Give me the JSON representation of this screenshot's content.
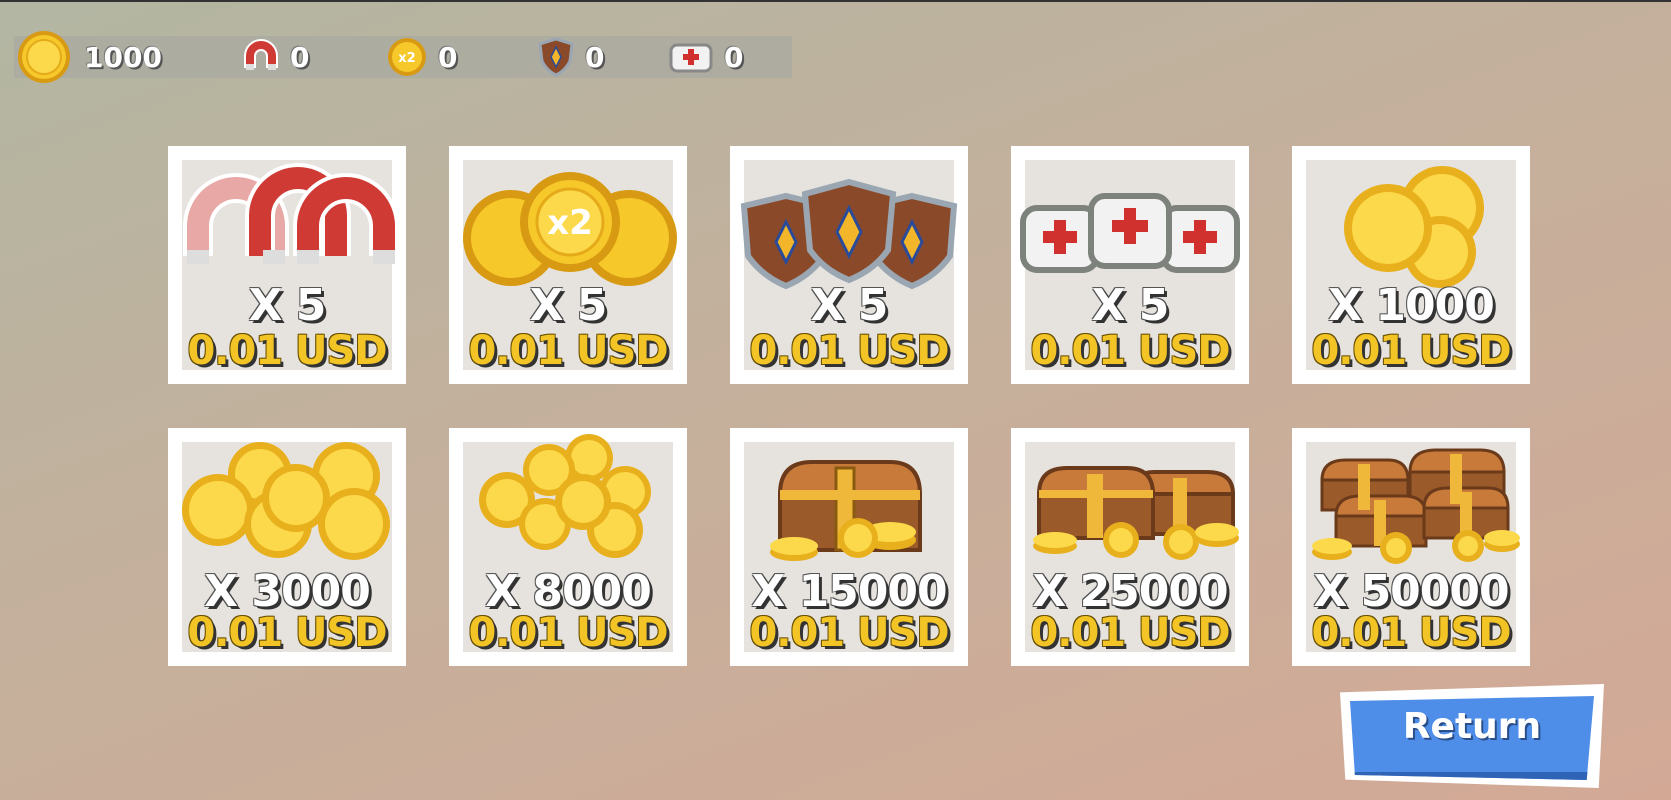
{
  "resources": {
    "coins": {
      "icon": "coin-icon",
      "value": "1000"
    },
    "magnet": {
      "icon": "magnet-icon",
      "value": "0"
    },
    "double_coins": {
      "icon": "x2-coin-icon",
      "value": "0"
    },
    "shield": {
      "icon": "shield-icon",
      "value": "0"
    },
    "medkit": {
      "icon": "medkit-icon",
      "value": "0"
    }
  },
  "shop": {
    "items": [
      {
        "icon": "magnets-icon",
        "qty": "X 5",
        "price": "0.01 USD"
      },
      {
        "icon": "x2-coins-icon",
        "qty": "X 5",
        "price": "0.01 USD",
        "art_text": "x2"
      },
      {
        "icon": "shields-icon",
        "qty": "X 5",
        "price": "0.01 USD"
      },
      {
        "icon": "medkits-icon",
        "qty": "X 5",
        "price": "0.01 USD"
      },
      {
        "icon": "coins-small-pile-icon",
        "qty": "X 1000",
        "price": "0.01 USD"
      },
      {
        "icon": "coins-pile-icon",
        "qty": "X 3000",
        "price": "0.01 USD"
      },
      {
        "icon": "coins-big-pile-icon",
        "qty": "X 8000",
        "price": "0.01 USD"
      },
      {
        "icon": "treasure-chest-icon",
        "qty": "X 15000",
        "price": "0.01 USD"
      },
      {
        "icon": "two-treasure-chests-icon",
        "qty": "X 25000",
        "price": "0.01 USD"
      },
      {
        "icon": "many-treasure-chests-icon",
        "qty": "X 50000",
        "price": "0.01 USD"
      }
    ]
  },
  "return_button": {
    "label": "Return"
  },
  "colors": {
    "gold": "#f3c426",
    "button_blue": "#4f8ee8",
    "magnet_red": "#c8302e",
    "wood": "#8a4a2a"
  }
}
